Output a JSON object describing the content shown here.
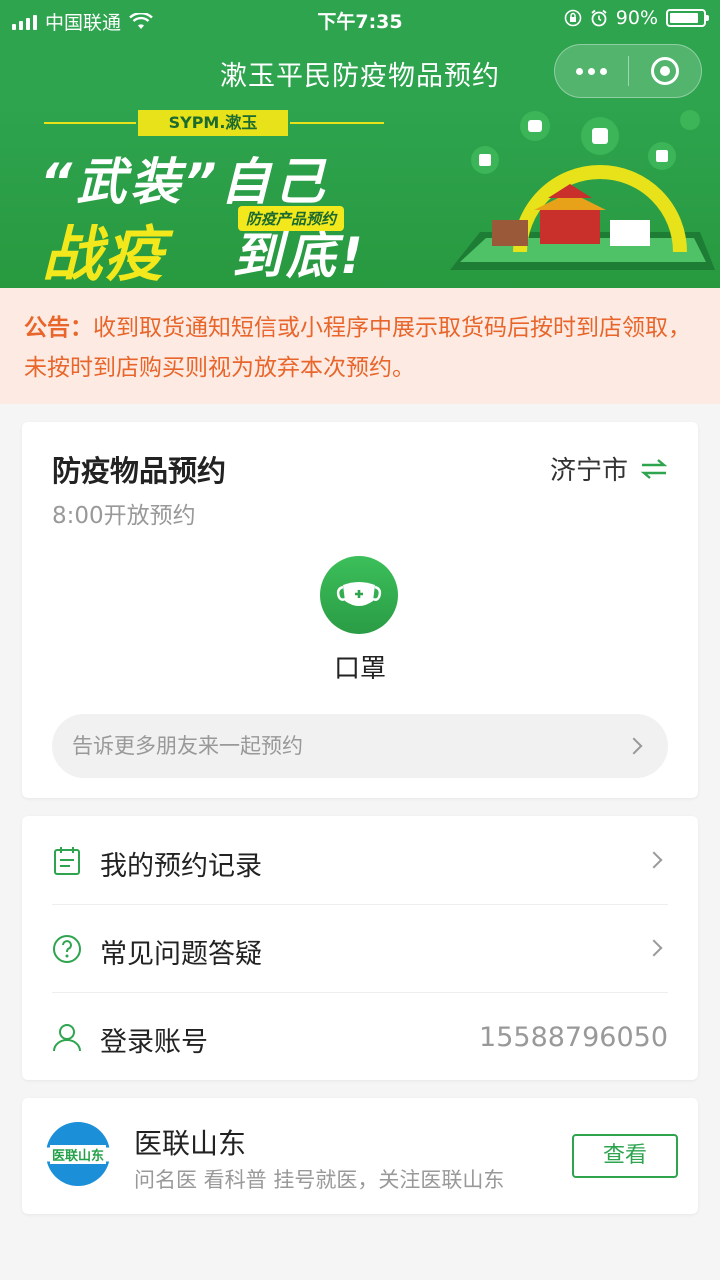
{
  "status_bar": {
    "carrier": "中国联通",
    "time": "下午7:35",
    "battery": "90%"
  },
  "nav": {
    "title": "漱玉平民防疫物品预约"
  },
  "banner": {
    "logo": "SYPM.漱玉",
    "line1": "“武装”自己",
    "tag": "防疫产品预约",
    "line2a": "战疫",
    "line2b": "到底!"
  },
  "notice": {
    "label": "公告：",
    "text": "收到取货通知短信或小程序中展示取货码后按时到店领取，未按时到店购买则视为放弃本次预约。"
  },
  "reservation": {
    "title": "防疫物品预约",
    "subtitle": "8:00开放预约",
    "city": "济宁市",
    "item_label": "口罩",
    "share_text": "告诉更多朋友来一起预约"
  },
  "menu": {
    "records": "我的预约记录",
    "faq": "常见问题答疑",
    "account": "登录账号",
    "account_value": "15588796050"
  },
  "ad": {
    "logo_text": "医联山东",
    "title": "医联山东",
    "subtitle": "问名医 看科普 挂号就医，关注医联山东",
    "button": "查看"
  },
  "colors": {
    "primary": "#2ea44f",
    "notice_bg": "#fdebe3",
    "notice_text": "#e8662b"
  }
}
